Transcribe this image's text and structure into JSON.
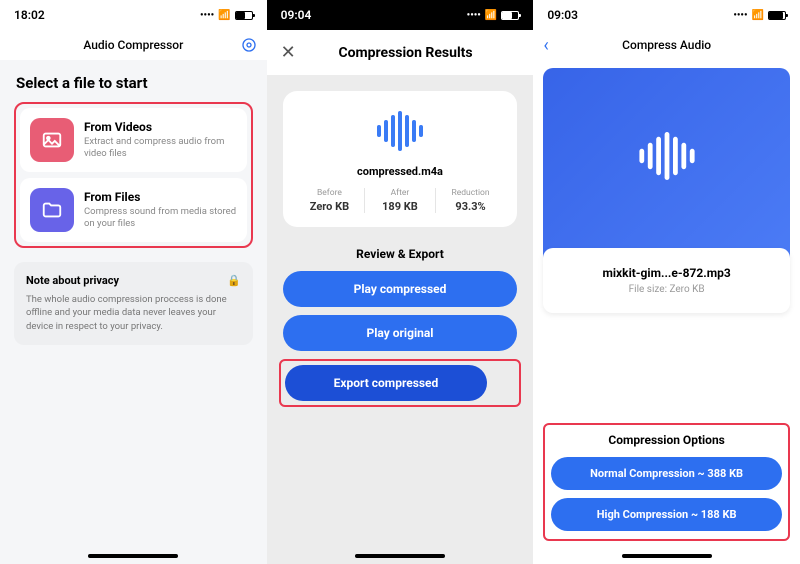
{
  "panel1": {
    "time": "18:02",
    "title": "Audio Compressor",
    "section_title": "Select a file to start",
    "options": [
      {
        "title": "From Videos",
        "desc": "Extract and compress audio from video files"
      },
      {
        "title": "From Files",
        "desc": "Compress sound from media stored on your files"
      }
    ],
    "privacy": {
      "title": "Note about privacy",
      "text": "The whole audio compression proccess is done offline and your media data never leaves your device in respect to your privacy."
    }
  },
  "panel2": {
    "time": "09:04",
    "title": "Compression Results",
    "filename": "compressed.m4a",
    "stats": [
      {
        "label": "Before",
        "value": "Zero KB"
      },
      {
        "label": "After",
        "value": "189 KB"
      },
      {
        "label": "Reduction",
        "value": "93.3%"
      }
    ],
    "review_title": "Review & Export",
    "buttons": {
      "play_compressed": "Play compressed",
      "play_original": "Play original",
      "export": "Export compressed"
    }
  },
  "panel3": {
    "time": "09:03",
    "title": "Compress Audio",
    "filename": "mixkit-gim...e-872.mp3",
    "filesize": "File size: Zero KB",
    "options_title": "Compression Options",
    "buttons": {
      "normal": "Normal Compression ~ 388 KB",
      "high": "High Compression ~ 188 KB"
    }
  }
}
